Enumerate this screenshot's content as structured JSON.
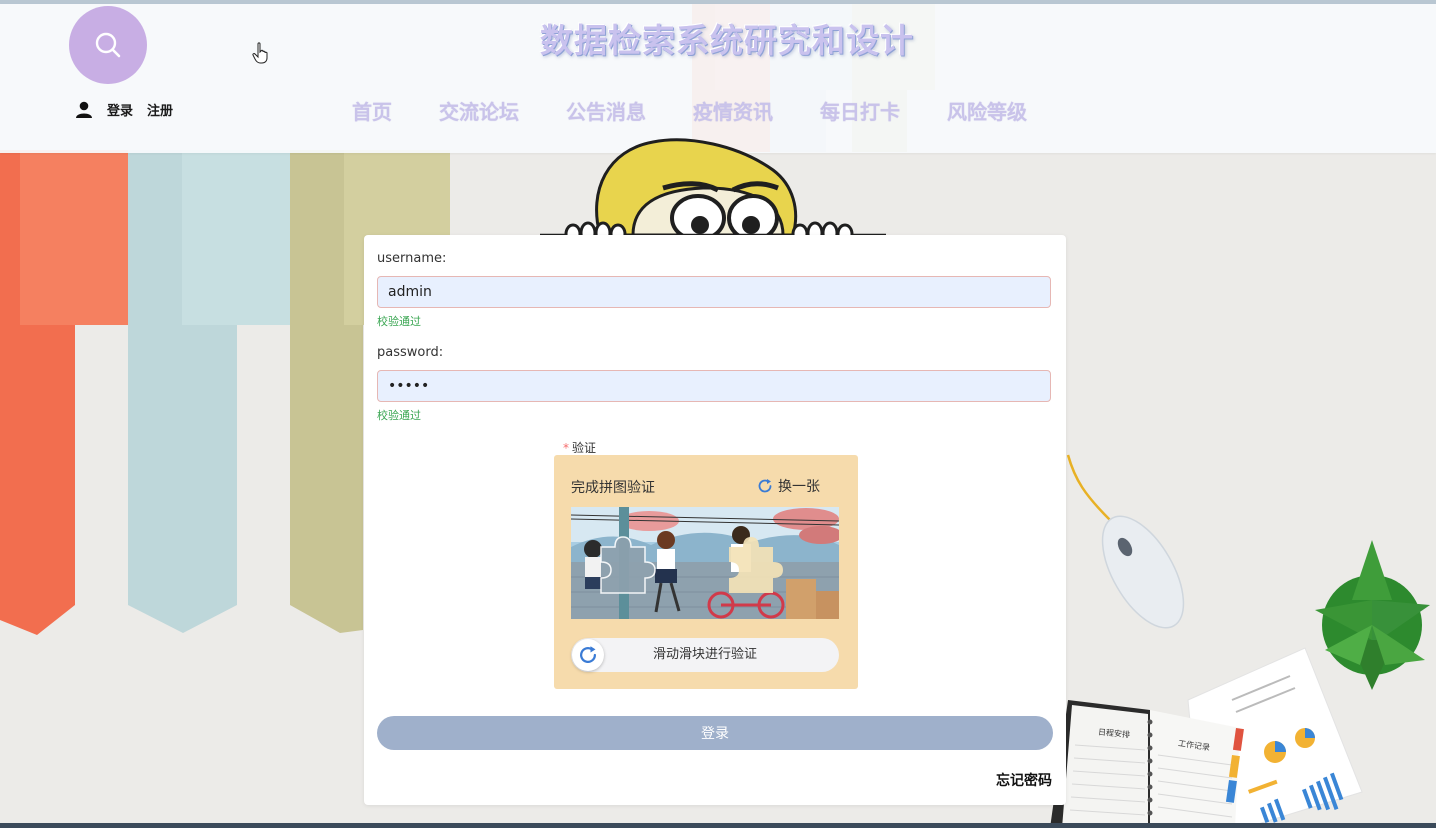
{
  "header": {
    "site_title": "数据检索系统研究和设计",
    "auth": {
      "login": "登录",
      "register": "注册"
    },
    "nav": [
      {
        "label": "首页"
      },
      {
        "label": "交流论坛"
      },
      {
        "label": "公告消息"
      },
      {
        "label": "疫情资讯"
      },
      {
        "label": "每日打卡"
      },
      {
        "label": "风险等级"
      }
    ]
  },
  "login_form": {
    "username": {
      "label": "username:",
      "value": "admin",
      "valid_text": "校验通过"
    },
    "password": {
      "label": "password:",
      "value": "•••••",
      "valid_text": "校验通过"
    },
    "captcha": {
      "required_mark": "*",
      "label": "验证",
      "title": "完成拼图验证",
      "refresh_label": "换一张",
      "slider_text": "滑动滑块进行验证"
    },
    "submit_label": "登录",
    "forgot_label": "忘记密码"
  },
  "notebook_text": {
    "left_page": "日程安排",
    "right_page": "工作记录"
  },
  "colors": {
    "accent_purple": "#c8aee4",
    "nav_text": "#c9c3ea",
    "valid_green": "#3aa652",
    "login_button": "#9fb0cb",
    "captcha_bg": "#f6dbac",
    "ribbon_orange": "#f26e4f",
    "ribbon_blue": "#bfd8dc",
    "ribbon_khaki": "#c9c695"
  },
  "icons": {
    "search": "search-icon",
    "user": "user-icon",
    "refresh": "refresh-icon",
    "slider": "refresh-icon"
  }
}
